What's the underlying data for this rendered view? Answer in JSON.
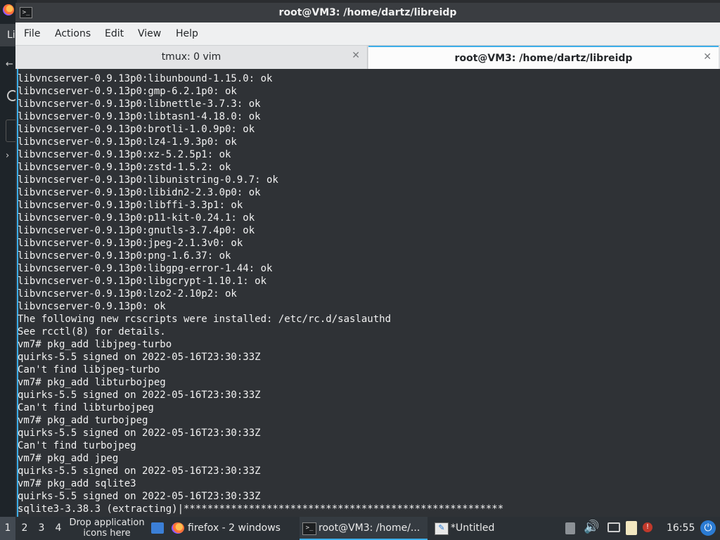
{
  "window": {
    "title": "root@VM3: /home/dartz/libreidp",
    "menu": [
      "File",
      "Actions",
      "Edit",
      "View",
      "Help"
    ],
    "tabs": [
      {
        "label": "tmux: 0 vim",
        "active": false
      },
      {
        "label": "root@VM3: /home/dartz/libreidp",
        "active": true
      }
    ]
  },
  "background_window": {
    "label": "Li"
  },
  "terminal": {
    "lines": [
      "libvncserver-0.9.13p0:libunbound-1.15.0: ok",
      "libvncserver-0.9.13p0:gmp-6.2.1p0: ok",
      "libvncserver-0.9.13p0:libnettle-3.7.3: ok",
      "libvncserver-0.9.13p0:libtasn1-4.18.0: ok",
      "libvncserver-0.9.13p0:brotli-1.0.9p0: ok",
      "libvncserver-0.9.13p0:lz4-1.9.3p0: ok",
      "libvncserver-0.9.13p0:xz-5.2.5p1: ok",
      "libvncserver-0.9.13p0:zstd-1.5.2: ok",
      "libvncserver-0.9.13p0:libunistring-0.9.7: ok",
      "libvncserver-0.9.13p0:libidn2-2.3.0p0: ok",
      "libvncserver-0.9.13p0:libffi-3.3p1: ok",
      "libvncserver-0.9.13p0:p11-kit-0.24.1: ok",
      "libvncserver-0.9.13p0:gnutls-3.7.4p0: ok",
      "libvncserver-0.9.13p0:jpeg-2.1.3v0: ok",
      "libvncserver-0.9.13p0:png-1.6.37: ok",
      "libvncserver-0.9.13p0:libgpg-error-1.44: ok",
      "libvncserver-0.9.13p0:libgcrypt-1.10.1: ok",
      "libvncserver-0.9.13p0:lzo2-2.10p2: ok",
      "libvncserver-0.9.13p0: ok",
      "The following new rcscripts were installed: /etc/rc.d/saslauthd",
      "See rcctl(8) for details.",
      "vm7# pkg_add libjpeg-turbo",
      "quirks-5.5 signed on 2022-05-16T23:30:33Z",
      "Can't find libjpeg-turbo",
      "vm7# pkg_add libturbojpeg",
      "quirks-5.5 signed on 2022-05-16T23:30:33Z",
      "Can't find libturbojpeg",
      "vm7# pkg_add turbojpeg",
      "quirks-5.5 signed on 2022-05-16T23:30:33Z",
      "Can't find turbojpeg",
      "vm7# pkg_add jpeg",
      "quirks-5.5 signed on 2022-05-16T23:30:33Z",
      "vm7# pkg_add sqlite3",
      "quirks-5.5 signed on 2022-05-16T23:30:33Z",
      "sqlite3-3.38.3 (extracting)|******************************************************"
    ]
  },
  "taskbar": {
    "workspaces": [
      "1",
      "2",
      "3",
      "4"
    ],
    "current_workspace": "1",
    "drop_hint": "Drop application icons here",
    "items": [
      {
        "label": "firefox - 2 windows",
        "icon": "firefox-icon",
        "active": false
      },
      {
        "label": "root@VM3: /home/...",
        "icon": "terminal-icon",
        "active": true
      },
      {
        "label": "*Untitled",
        "icon": "text-editor-icon",
        "active": false
      }
    ],
    "clock": "16:55"
  },
  "colors": {
    "terminal_bg": "#2f3236",
    "accent": "#3daee9",
    "taskbar_bg": "#2b3035"
  }
}
